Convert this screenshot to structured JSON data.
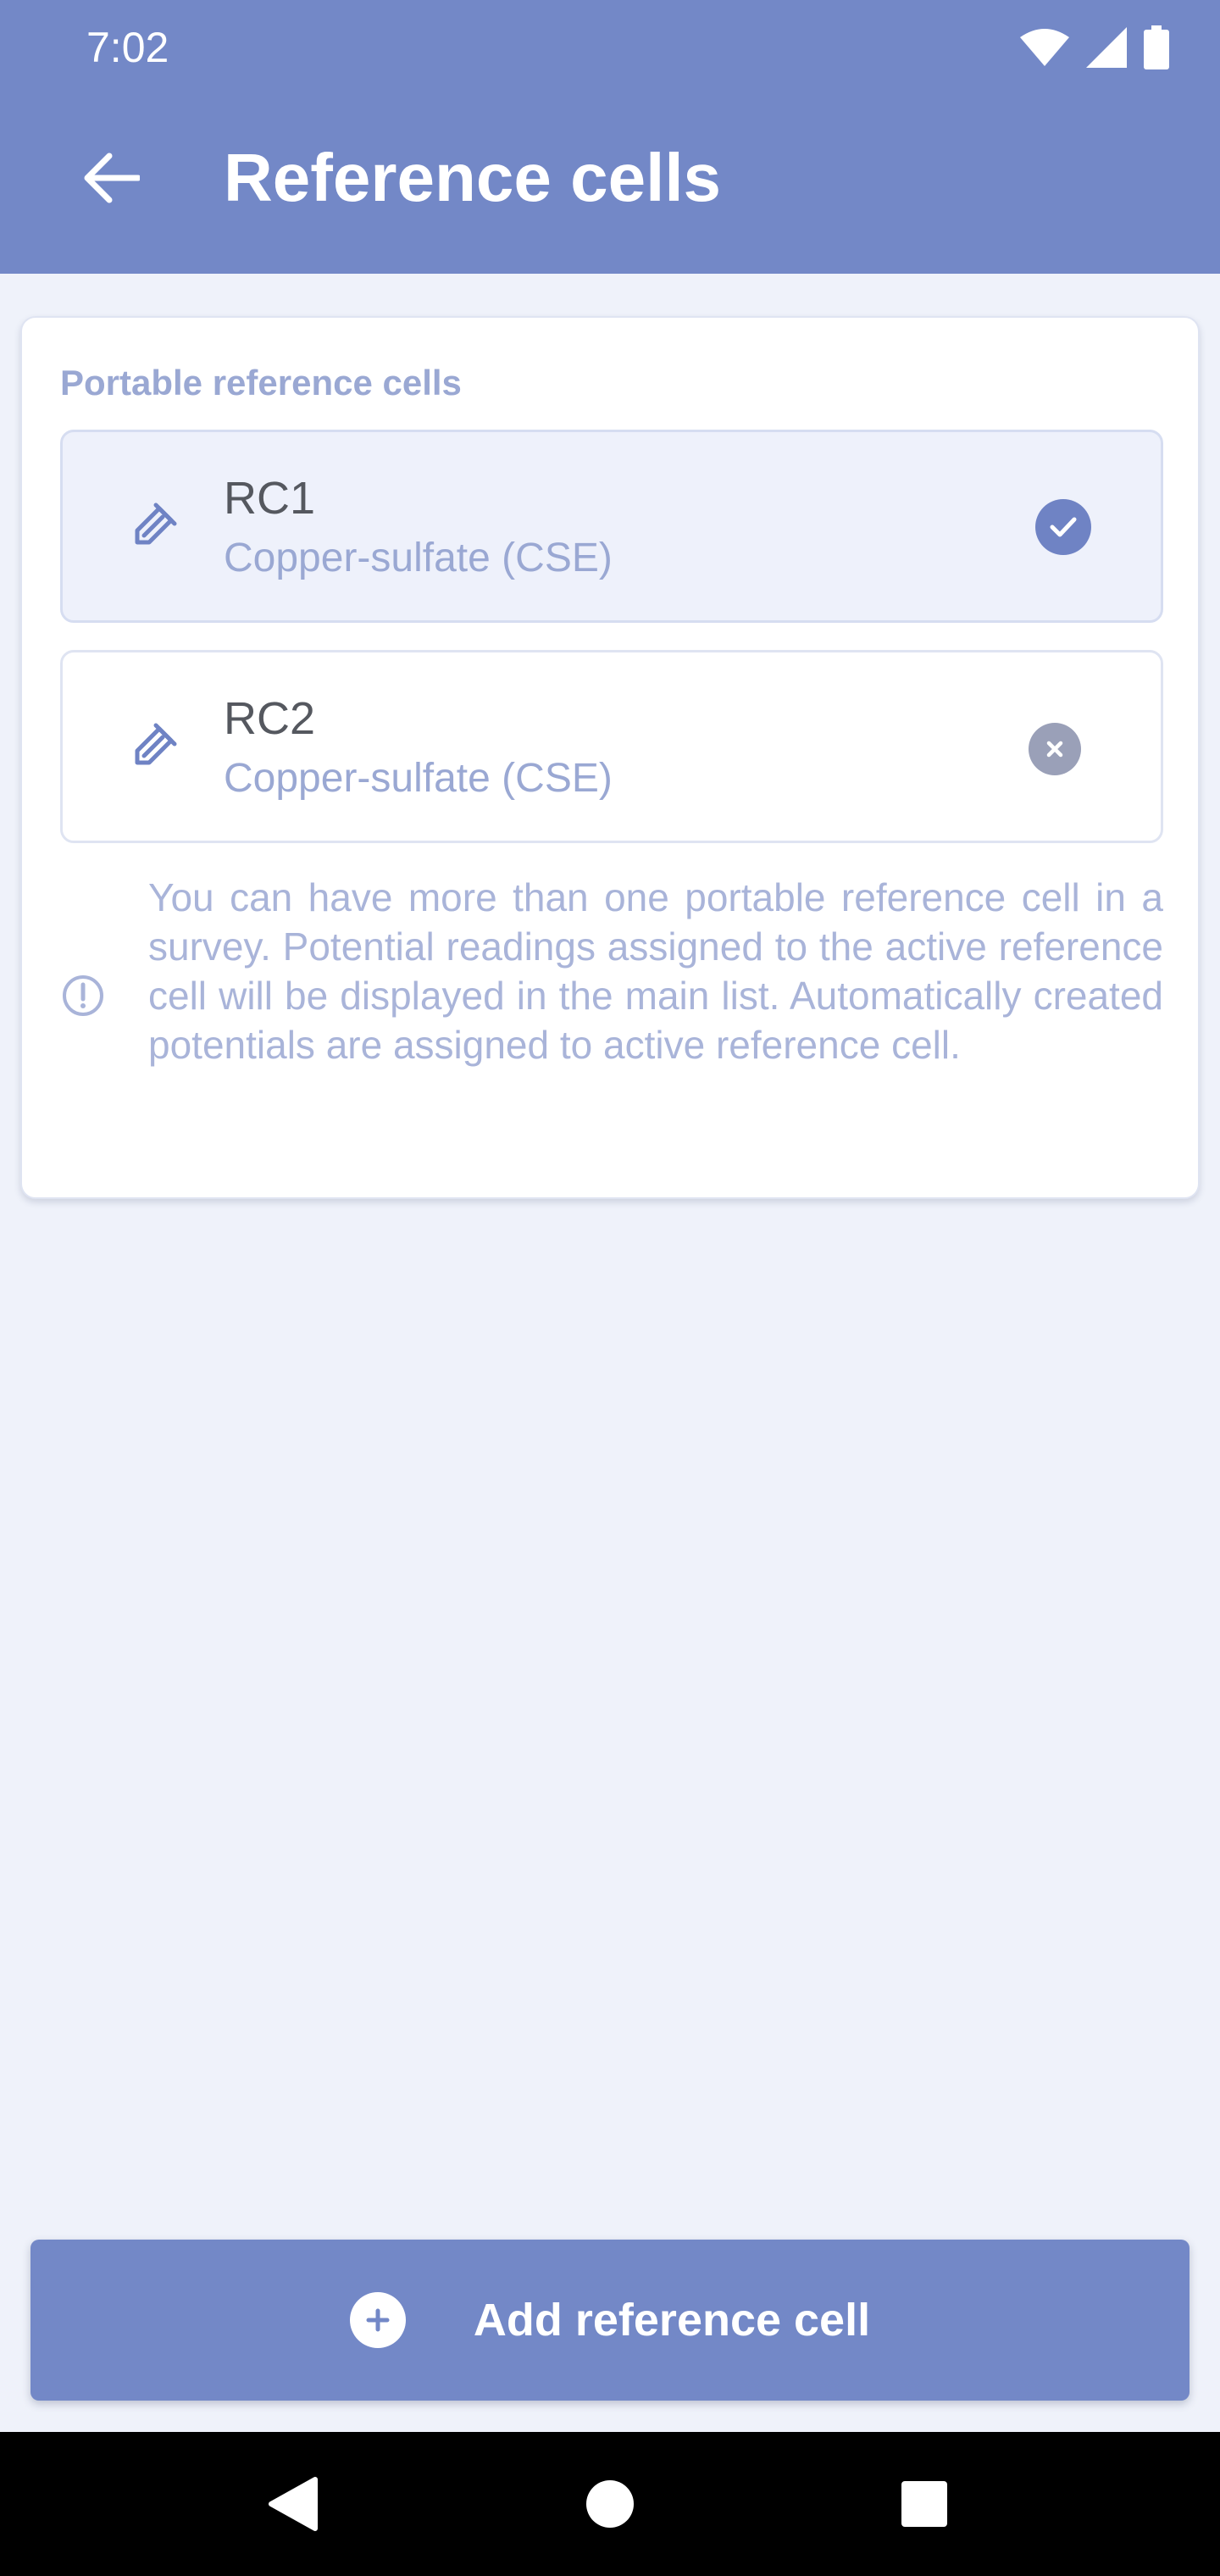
{
  "status_bar": {
    "time": "7:02"
  },
  "app_bar": {
    "title": "Reference cells",
    "back_icon": "arrow-left-icon"
  },
  "section": {
    "label": "Portable reference cells",
    "cells": [
      {
        "name": "RC1",
        "type": "Copper-sulfate (CSE)",
        "status": "active",
        "icon": "probe-icon"
      },
      {
        "name": "RC2",
        "type": "Copper-sulfate (CSE)",
        "status": "inactive",
        "icon": "probe-icon"
      }
    ],
    "info_text": "You can have more than one portable reference cell in a survey. Potential readings assigned to the active reference cell will be displayed in the main list. Automatically created potentials are assigned to active reference cell."
  },
  "add_button": {
    "label": "Add reference cell",
    "icon": "plus-circle-icon"
  },
  "colors": {
    "primary": "#7388c7",
    "background": "#eff2fa",
    "muted_text": "#9aa8d3"
  }
}
